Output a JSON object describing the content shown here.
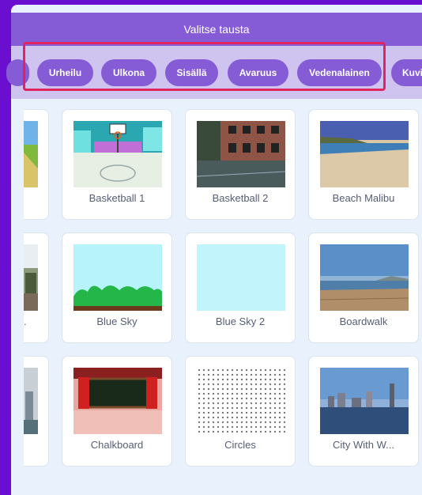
{
  "header": {
    "title": "Valitse tausta"
  },
  "categories": [
    "",
    "Urheilu",
    "Ulkona",
    "Sisällä",
    "Avaruus",
    "Vedenalainen",
    "Kuvi"
  ],
  "rows": [
    {
      "partial_label": "",
      "cards": [
        {
          "name": "Basketball 1",
          "thumb": "basketball-1"
        },
        {
          "name": "Basketball 2",
          "thumb": "basketball-2"
        },
        {
          "name": "Beach Malibu",
          "thumb": "beach-malibu"
        }
      ]
    },
    {
      "partial_label": ".",
      "cards": [
        {
          "name": "Blue Sky",
          "thumb": "blue-sky"
        },
        {
          "name": "Blue Sky 2",
          "thumb": "blue-sky-2"
        },
        {
          "name": "Boardwalk",
          "thumb": "boardwalk"
        }
      ]
    },
    {
      "partial_label": "",
      "cards": [
        {
          "name": "Chalkboard",
          "thumb": "chalkboard"
        },
        {
          "name": "Circles",
          "thumb": "circles"
        },
        {
          "name": "City With W...",
          "thumb": "city-with-water"
        }
      ]
    }
  ],
  "colors": {
    "accent": "#855cd6",
    "background": "#6a0fd0",
    "highlight": "#e0245e"
  }
}
